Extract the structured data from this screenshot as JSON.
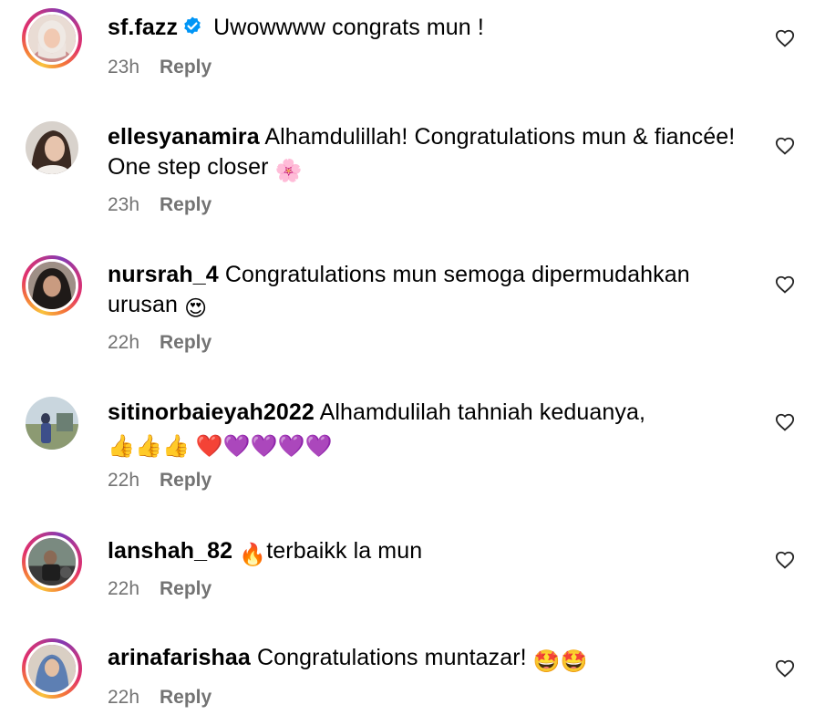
{
  "comments": [
    {
      "username": "sf.fazz",
      "verified": true,
      "text": "Uwowwww congrats mun !",
      "time": "23h",
      "reply_label": "Reply"
    },
    {
      "username": "ellesyanamira",
      "verified": false,
      "text": "Alhamdulillah! Congratulations mun & fiancée! One step closer",
      "emoji": "🌸",
      "time": "23h",
      "reply_label": "Reply"
    },
    {
      "username": "nursrah_4",
      "verified": false,
      "text": "Congratulations mun semoga dipermudahkan urusan",
      "emoji": "😍",
      "time": "22h",
      "reply_label": "Reply"
    },
    {
      "username": "sitinorbaieyah2022",
      "verified": false,
      "text": "Alhamdulilah tahniah keduanya,",
      "emoji": "👍👍👍 ❤️💜💜💜💜",
      "time": "22h",
      "reply_label": "Reply"
    },
    {
      "username": "lanshah_82",
      "verified": false,
      "emoji": "🔥",
      "text": "terbaikk la mun",
      "time": "22h",
      "reply_label": "Reply"
    },
    {
      "username": "arinafarishaa",
      "verified": false,
      "text": "Congratulations muntazar!",
      "emoji": "🤩🤩",
      "time": "22h",
      "reply_label": "Reply"
    }
  ],
  "icons": {
    "verified": "verified-badge-icon",
    "like": "heart-outline-icon"
  },
  "colors": {
    "secondary_text": "#737373",
    "verified_blue": "#0095f6"
  }
}
